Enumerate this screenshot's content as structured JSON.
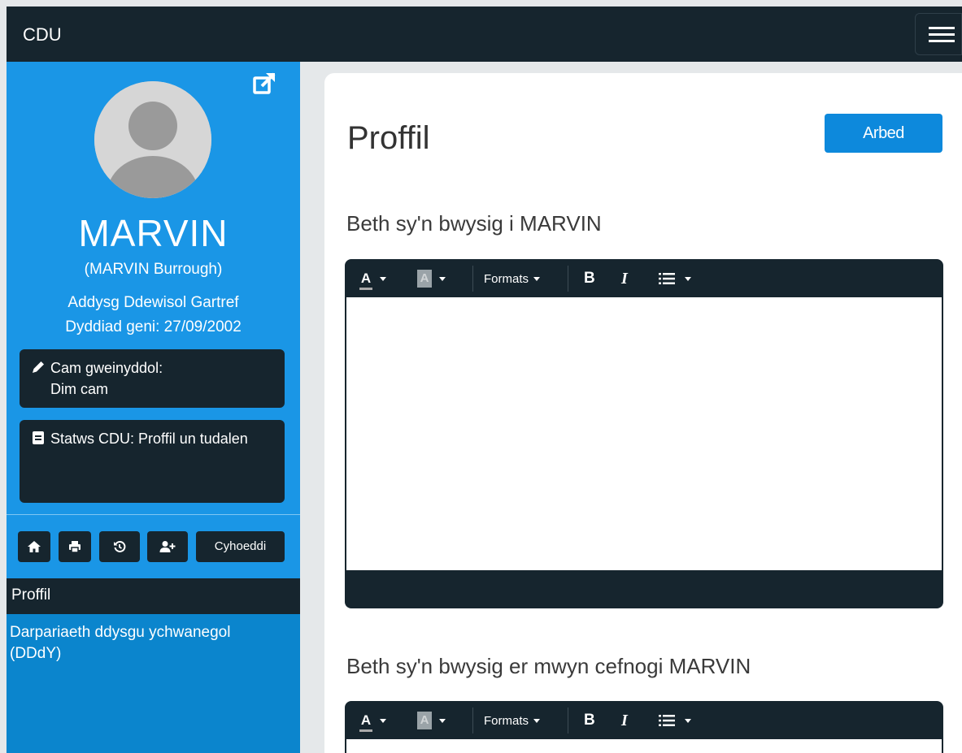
{
  "header": {
    "brand": "CDU",
    "menu_icon": "hamburger-icon"
  },
  "sidebar": {
    "external_link_icon": "external-link-icon",
    "avatar_icon": "user-avatar-icon",
    "pupil_name": "MARVIN",
    "pupil_fullname": "(MARVIN Burrough)",
    "school": "Addysg Ddewisol Gartref",
    "dob": "Dyddiad geni: 27/09/2002",
    "admin_stage": {
      "icon": "pencil-icon",
      "label": "Cam gweinyddol:",
      "value": "Dim cam"
    },
    "status": {
      "icon": "book-icon",
      "text": "Statws CDU: Proffil un tudalen"
    },
    "actions": [
      {
        "icon": "home-icon"
      },
      {
        "icon": "print-icon"
      },
      {
        "icon": "history-icon"
      },
      {
        "icon": "add-user-icon"
      },
      {
        "label": "Cyhoeddi"
      }
    ],
    "nav": [
      {
        "label": "Proffil",
        "active": true
      },
      {
        "label": "Darpariaeth ddysgu ychwanegol (DDdY)",
        "active": false
      }
    ]
  },
  "main": {
    "title": "Proffil",
    "save_label": "Arbed",
    "sections": [
      {
        "heading": "Beth sy'n bwysig i MARVIN"
      },
      {
        "heading": "Beth sy'n bwysig er mwyn cefnogi MARVIN"
      }
    ],
    "editor_toolbar": {
      "text_color_letter": "A",
      "bg_color_letter": "A",
      "formats_label": "Formats",
      "bold_label": "B",
      "italic_label": "I",
      "list_icon": "list-icon"
    }
  },
  "colors": {
    "dark": "#16252e",
    "sidebar_blue": "#1a96e6",
    "nav_blue": "#0b85cd",
    "button_blue": "#0d89dc"
  }
}
